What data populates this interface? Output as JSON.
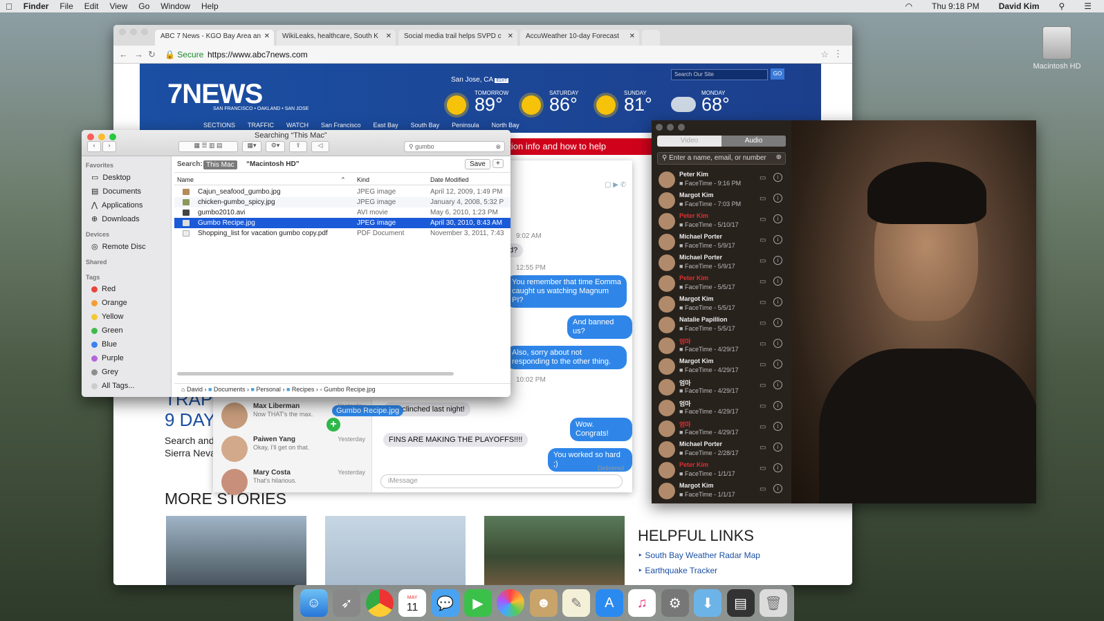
{
  "menubar": {
    "apple": "",
    "app": "Finder",
    "items": [
      "File",
      "Edit",
      "View",
      "Go",
      "Window",
      "Help"
    ],
    "clock": "Thu 9:18 PM",
    "user": "David Kim"
  },
  "desktop": {
    "hd_label": "Macintosh HD"
  },
  "browser": {
    "tabs": [
      "ABC 7 News - KGO Bay Area an",
      "WikiLeaks, healthcare, South K",
      "Social media trail helps SVPD c",
      "AccuWeather 10-day Forecast"
    ],
    "secure": "Secure",
    "url": "https://www.abc7news.com",
    "site": {
      "logo": "7NEWS",
      "logo_sub": "SAN FRANCISCO • OAKLAND • SAN JOSE",
      "city": "San Jose, CA",
      "edit": "EDIT",
      "weather": [
        {
          "day": "TOMORROW",
          "temp": "89°",
          "icon": "sun-icon"
        },
        {
          "day": "SATURDAY",
          "temp": "86°",
          "icon": "sun-icon"
        },
        {
          "day": "SUNDAY",
          "temp": "81°",
          "icon": "sun-icon"
        },
        {
          "day": "MONDAY",
          "temp": "68°",
          "icon": "rain-cloud-icon"
        }
      ],
      "search_placeholder": "Search Our Site",
      "go": "GO",
      "nav": [
        "SECTIONS",
        "TRAFFIC",
        "WATCH",
        "San Francisco",
        "East Bay",
        "South Bay",
        "Peninsula",
        "North Bay"
      ],
      "red_banner": "ation info and how to help",
      "trap_1": "TRAP",
      "trap_2": "9 DAY",
      "trap_sub_1": "Search and",
      "trap_sub_2": "Sierra Neva",
      "more_stories": "MORE STORIES",
      "helpful": "HELPFUL LINKS",
      "links": [
        "South Bay Weather Radar Map",
        "Earthquake Tracker"
      ]
    }
  },
  "messages": {
    "convs": [
      {
        "name": "Max Liberman",
        "preview": "Now THAT's the max.",
        "time": "Yesterday"
      },
      {
        "name": "Paiwen Yang",
        "preview": "Okay, I'll get on that.",
        "time": "Yesterday"
      },
      {
        "name": "Mary Costa",
        "preview": "That's hilarious.",
        "time": "Yesterday"
      }
    ],
    "ts": [
      "9:02 AM",
      "12:55 PM",
      "10:02 PM"
    ],
    "bubbles": [
      "You remember that time Eomma caught us watching Magnum PI?",
      "And banned us?",
      "Also, sorry about not responding to the other thing.",
      "Wow. Congrats!",
      "You worked so hard ;)"
    ],
    "gray": [
      "d?",
      "We clinched last night!",
      "FINS ARE MAKING THE PLAYOFFS!!!!"
    ],
    "delivered": "Delivered",
    "placeholder": "iMessage",
    "drag_file": "Gumbo Recipe.jpg"
  },
  "finder": {
    "title": "Searching “This Mac”",
    "search": "gumbo",
    "scope_label": "Search:",
    "scope_active": "This Mac",
    "scope_other": "“Macintosh HD”",
    "save": "Save",
    "plus": "+",
    "sidebar": {
      "favorites": "Favorites",
      "fav_items": [
        "Desktop",
        "Documents",
        "Applications",
        "Downloads"
      ],
      "devices": "Devices",
      "dev_items": [
        "Remote Disc"
      ],
      "shared": "Shared",
      "tags": "Tags",
      "tag_items": [
        {
          "name": "Red",
          "color": "#e8453c"
        },
        {
          "name": "Orange",
          "color": "#f39c34"
        },
        {
          "name": "Yellow",
          "color": "#f2c835"
        },
        {
          "name": "Green",
          "color": "#3fba4a"
        },
        {
          "name": "Blue",
          "color": "#3a82f0"
        },
        {
          "name": "Purple",
          "color": "#b565d9"
        },
        {
          "name": "Grey",
          "color": "#8e8e8e"
        }
      ],
      "all_tags": "All Tags..."
    },
    "columns": [
      "Name",
      "Kind",
      "Date Modified"
    ],
    "rows": [
      {
        "name": "Cajun_seafood_gumbo.jpg",
        "kind": "JPEG image",
        "date": "April 12, 2009, 1:49 PM"
      },
      {
        "name": "chicken-gumbo_spicy.jpg",
        "kind": "JPEG image",
        "date": "January 4, 2008, 5:32 P"
      },
      {
        "name": "gumbo2010.avi",
        "kind": "AVI movie",
        "date": "May 6, 2010, 1:23 PM"
      },
      {
        "name": "Gumbo Recipe.jpg",
        "kind": "JPEG image",
        "date": "April 30, 2010, 8:43 AM"
      },
      {
        "name": "Shopping_list for vacation gumbo copy.pdf",
        "kind": "PDF Document",
        "date": "November 3, 2011, 7:43"
      }
    ],
    "path": [
      "David",
      "Documents",
      "Personal",
      "Recipes",
      "Gumbo Recipe.jpg"
    ]
  },
  "facetime": {
    "tab_video": "Video",
    "tab_audio": "Audio",
    "search": "Enter a name, email, or number",
    "calls": [
      {
        "name": "Peter Kim",
        "sub": "FaceTime - 9:16 PM",
        "red": false
      },
      {
        "name": "Margot Kim",
        "sub": "FaceTime - 7:03 PM",
        "red": false
      },
      {
        "name": "Peter Kim",
        "sub": "FaceTime - 5/10/17",
        "red": true
      },
      {
        "name": "Michael Porter",
        "sub": "FaceTime - 5/9/17",
        "red": false
      },
      {
        "name": "Michael Porter",
        "sub": "FaceTime - 5/9/17",
        "red": false
      },
      {
        "name": "Peter Kim",
        "sub": "FaceTime - 5/5/17",
        "red": true
      },
      {
        "name": "Margot Kim",
        "sub": "FaceTime - 5/5/17",
        "red": false
      },
      {
        "name": "Natalie Papillion",
        "sub": "FaceTime - 5/5/17",
        "red": false
      },
      {
        "name": "엄마",
        "sub": "FaceTime - 4/29/17",
        "red": true
      },
      {
        "name": "Margot Kim",
        "sub": "FaceTime - 4/29/17",
        "red": false
      },
      {
        "name": "엄마",
        "sub": "FaceTime - 4/29/17",
        "red": false
      },
      {
        "name": "엄마",
        "sub": "FaceTime - 4/29/17",
        "red": false
      },
      {
        "name": "엄마",
        "sub": "FaceTime - 4/29/17",
        "red": true
      },
      {
        "name": "Michael Porter",
        "sub": "FaceTime - 2/28/17",
        "red": false
      },
      {
        "name": "Peter Kim",
        "sub": "FaceTime - 1/1/17",
        "red": true
      },
      {
        "name": "Margot Kim",
        "sub": "FaceTime - 1/1/17",
        "red": false
      }
    ]
  },
  "dock": {
    "calendar_month": "MAY",
    "calendar_day": "11"
  }
}
